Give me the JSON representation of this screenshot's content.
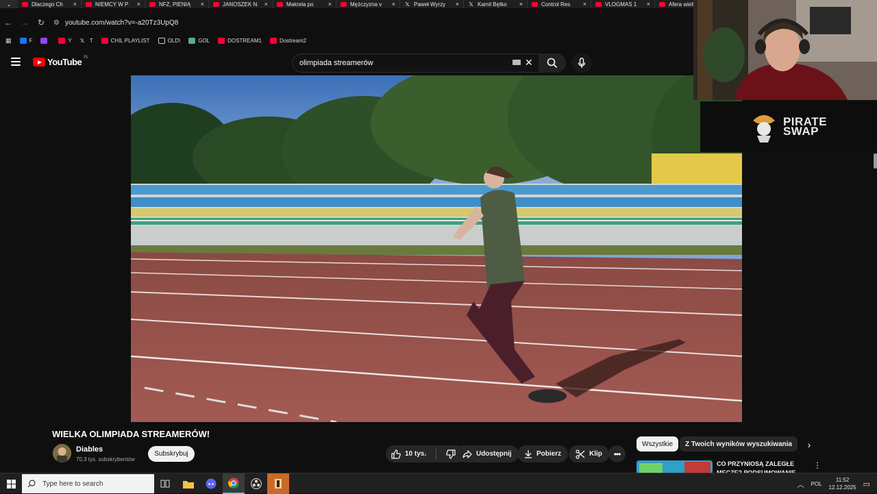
{
  "browser": {
    "tabs": [
      {
        "title": "Dlaczego Ch",
        "icon": "youtube-icon"
      },
      {
        "title": "NIEMCY W P",
        "icon": "youtube-icon"
      },
      {
        "title": "NFZ, PIENIĄ",
        "icon": "youtube-icon"
      },
      {
        "title": "JANOSZEK N",
        "icon": "youtube-icon"
      },
      {
        "title": "Makrela po",
        "icon": "youtube-icon"
      },
      {
        "title": "Mężczyzna v",
        "icon": "youtube-icon"
      },
      {
        "title": "Paweł Wyrzy",
        "icon": "x-icon"
      },
      {
        "title": "Kamil Bętko",
        "icon": "x-icon"
      },
      {
        "title": "Control Res",
        "icon": "youtube-icon"
      },
      {
        "title": "VLOGMAS 1",
        "icon": "youtube-icon"
      },
      {
        "title": "Afera wielk",
        "icon": "youtube-icon"
      }
    ],
    "url": "youtube.com/watch?v=-a20Tz3UpQ8",
    "bookmarks": [
      {
        "label": "F",
        "icon": "facebook-icon",
        "color": "#1877f2"
      },
      {
        "label": "",
        "icon": "twitch-icon",
        "color": "#9146ff"
      },
      {
        "label": "Y",
        "icon": "youtube-icon",
        "color": "#ff0033"
      },
      {
        "label": "T",
        "icon": "x-icon",
        "color": "#ffffff"
      },
      {
        "label": "CHIL PLAYLIST",
        "icon": "youtube-icon",
        "color": "#ff0033"
      },
      {
        "label": "OLD\\",
        "icon": "folder-icon",
        "color": "#cccccc"
      },
      {
        "label": "GOL",
        "icon": "gol-icon",
        "color": "#5a9"
      },
      {
        "label": "DOSTREAM1",
        "icon": "youtube-icon",
        "color": "#ff0033"
      },
      {
        "label": "Dostream2",
        "icon": "youtube-icon",
        "color": "#ff0033"
      }
    ]
  },
  "youtube": {
    "logo_text": "YouTube",
    "region": "PL",
    "search_query": "olimpiada streamerów",
    "video": {
      "title": "WIELKA OLIMPIADA STREAMERÓW!",
      "channel": "Diables",
      "subscribers": "70,3 tys. subskrybentów",
      "subscribe_label": "Subskrybuj",
      "likes": "10 tys.",
      "share_label": "Udostępnij",
      "download_label": "Pobierz",
      "clip_label": "Klip"
    },
    "chips": [
      "Wszystkie",
      "Z Twoich wyników wyszukiwania"
    ],
    "recommendation": {
      "title": "CO PRZYNIOSĄ ZALEGŁE MECZE? PODSUMOWANIE"
    }
  },
  "overlay": {
    "sponsor_line1": "PIRATE",
    "sponsor_line2": "SWAP"
  },
  "taskbar": {
    "search_placeholder": "Type here to search",
    "language": "POL",
    "time": "11:52",
    "date": "12.12.2025"
  }
}
